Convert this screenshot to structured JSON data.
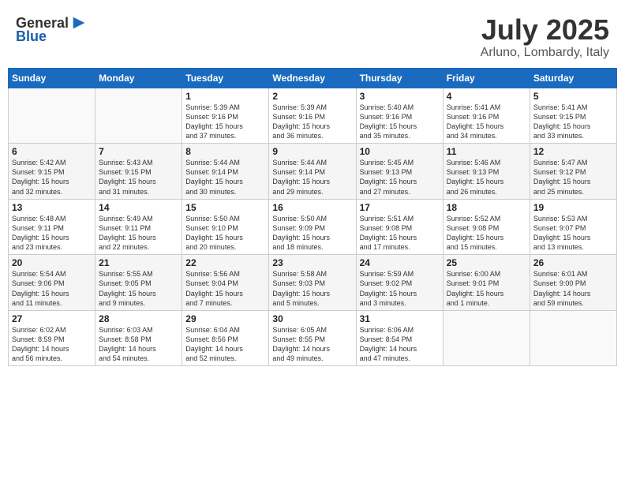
{
  "header": {
    "logo_general": "General",
    "logo_blue": "Blue",
    "month": "July 2025",
    "location": "Arluno, Lombardy, Italy"
  },
  "weekdays": [
    "Sunday",
    "Monday",
    "Tuesday",
    "Wednesday",
    "Thursday",
    "Friday",
    "Saturday"
  ],
  "weeks": [
    [
      {
        "day": "",
        "info": ""
      },
      {
        "day": "",
        "info": ""
      },
      {
        "day": "1",
        "info": "Sunrise: 5:39 AM\nSunset: 9:16 PM\nDaylight: 15 hours\nand 37 minutes."
      },
      {
        "day": "2",
        "info": "Sunrise: 5:39 AM\nSunset: 9:16 PM\nDaylight: 15 hours\nand 36 minutes."
      },
      {
        "day": "3",
        "info": "Sunrise: 5:40 AM\nSunset: 9:16 PM\nDaylight: 15 hours\nand 35 minutes."
      },
      {
        "day": "4",
        "info": "Sunrise: 5:41 AM\nSunset: 9:16 PM\nDaylight: 15 hours\nand 34 minutes."
      },
      {
        "day": "5",
        "info": "Sunrise: 5:41 AM\nSunset: 9:15 PM\nDaylight: 15 hours\nand 33 minutes."
      }
    ],
    [
      {
        "day": "6",
        "info": "Sunrise: 5:42 AM\nSunset: 9:15 PM\nDaylight: 15 hours\nand 32 minutes."
      },
      {
        "day": "7",
        "info": "Sunrise: 5:43 AM\nSunset: 9:15 PM\nDaylight: 15 hours\nand 31 minutes."
      },
      {
        "day": "8",
        "info": "Sunrise: 5:44 AM\nSunset: 9:14 PM\nDaylight: 15 hours\nand 30 minutes."
      },
      {
        "day": "9",
        "info": "Sunrise: 5:44 AM\nSunset: 9:14 PM\nDaylight: 15 hours\nand 29 minutes."
      },
      {
        "day": "10",
        "info": "Sunrise: 5:45 AM\nSunset: 9:13 PM\nDaylight: 15 hours\nand 27 minutes."
      },
      {
        "day": "11",
        "info": "Sunrise: 5:46 AM\nSunset: 9:13 PM\nDaylight: 15 hours\nand 26 minutes."
      },
      {
        "day": "12",
        "info": "Sunrise: 5:47 AM\nSunset: 9:12 PM\nDaylight: 15 hours\nand 25 minutes."
      }
    ],
    [
      {
        "day": "13",
        "info": "Sunrise: 5:48 AM\nSunset: 9:11 PM\nDaylight: 15 hours\nand 23 minutes."
      },
      {
        "day": "14",
        "info": "Sunrise: 5:49 AM\nSunset: 9:11 PM\nDaylight: 15 hours\nand 22 minutes."
      },
      {
        "day": "15",
        "info": "Sunrise: 5:50 AM\nSunset: 9:10 PM\nDaylight: 15 hours\nand 20 minutes."
      },
      {
        "day": "16",
        "info": "Sunrise: 5:50 AM\nSunset: 9:09 PM\nDaylight: 15 hours\nand 18 minutes."
      },
      {
        "day": "17",
        "info": "Sunrise: 5:51 AM\nSunset: 9:08 PM\nDaylight: 15 hours\nand 17 minutes."
      },
      {
        "day": "18",
        "info": "Sunrise: 5:52 AM\nSunset: 9:08 PM\nDaylight: 15 hours\nand 15 minutes."
      },
      {
        "day": "19",
        "info": "Sunrise: 5:53 AM\nSunset: 9:07 PM\nDaylight: 15 hours\nand 13 minutes."
      }
    ],
    [
      {
        "day": "20",
        "info": "Sunrise: 5:54 AM\nSunset: 9:06 PM\nDaylight: 15 hours\nand 11 minutes."
      },
      {
        "day": "21",
        "info": "Sunrise: 5:55 AM\nSunset: 9:05 PM\nDaylight: 15 hours\nand 9 minutes."
      },
      {
        "day": "22",
        "info": "Sunrise: 5:56 AM\nSunset: 9:04 PM\nDaylight: 15 hours\nand 7 minutes."
      },
      {
        "day": "23",
        "info": "Sunrise: 5:58 AM\nSunset: 9:03 PM\nDaylight: 15 hours\nand 5 minutes."
      },
      {
        "day": "24",
        "info": "Sunrise: 5:59 AM\nSunset: 9:02 PM\nDaylight: 15 hours\nand 3 minutes."
      },
      {
        "day": "25",
        "info": "Sunrise: 6:00 AM\nSunset: 9:01 PM\nDaylight: 15 hours\nand 1 minute."
      },
      {
        "day": "26",
        "info": "Sunrise: 6:01 AM\nSunset: 9:00 PM\nDaylight: 14 hours\nand 59 minutes."
      }
    ],
    [
      {
        "day": "27",
        "info": "Sunrise: 6:02 AM\nSunset: 8:59 PM\nDaylight: 14 hours\nand 56 minutes."
      },
      {
        "day": "28",
        "info": "Sunrise: 6:03 AM\nSunset: 8:58 PM\nDaylight: 14 hours\nand 54 minutes."
      },
      {
        "day": "29",
        "info": "Sunrise: 6:04 AM\nSunset: 8:56 PM\nDaylight: 14 hours\nand 52 minutes."
      },
      {
        "day": "30",
        "info": "Sunrise: 6:05 AM\nSunset: 8:55 PM\nDaylight: 14 hours\nand 49 minutes."
      },
      {
        "day": "31",
        "info": "Sunrise: 6:06 AM\nSunset: 8:54 PM\nDaylight: 14 hours\nand 47 minutes."
      },
      {
        "day": "",
        "info": ""
      },
      {
        "day": "",
        "info": ""
      }
    ]
  ]
}
